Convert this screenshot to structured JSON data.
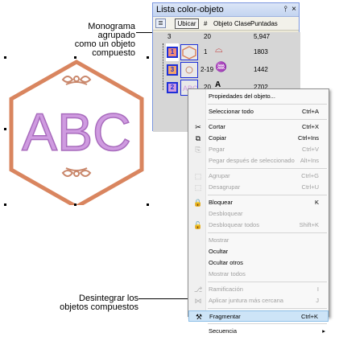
{
  "callouts": {
    "top": [
      "Monograma agrupado",
      "como un objeto",
      "compuesto"
    ],
    "bottom": [
      "Desintegrar los",
      "objetos compuestos"
    ]
  },
  "panel": {
    "title": "Lista color-objeto",
    "title_controls": [
      "p",
      "×"
    ],
    "toolbar": {
      "locate_button": "Ubicar",
      "columns": [
        "#",
        "Objeto",
        "Clase",
        "Puntadas"
      ]
    },
    "header_row": {
      "num": "3",
      "count": "20",
      "stitches": "5,947"
    },
    "rows": [
      {
        "index": "1",
        "num": "1",
        "stitches": "1803"
      },
      {
        "index": "3",
        "num": "2-19",
        "stitches": "1442"
      },
      {
        "index": "2",
        "num": "20",
        "stitches": "2702"
      }
    ]
  },
  "design": {
    "monogram_text": "ABC",
    "colors": {
      "hexagon": "#d9855f",
      "letters": "#cf9be0",
      "letter_stroke": "#a86bbd",
      "ornament": "#c9876b"
    }
  },
  "menu": {
    "items": [
      {
        "label": "Propiedades del objeto...",
        "shortcut": "",
        "disabled": false,
        "icon": ""
      },
      {
        "sep": true
      },
      {
        "label": "Seleccionar todo",
        "shortcut": "Ctrl+A",
        "disabled": false,
        "icon": ""
      },
      {
        "sep": true
      },
      {
        "label": "Cortar",
        "shortcut": "Ctrl+X",
        "disabled": false,
        "icon": "scissors-icon"
      },
      {
        "label": "Copiar",
        "shortcut": "Ctrl+Ins",
        "disabled": false,
        "icon": "copy-icon"
      },
      {
        "label": "Pegar",
        "shortcut": "Ctrl+V",
        "disabled": true,
        "icon": "paste-icon"
      },
      {
        "label": "Pegar después de seleccionado",
        "shortcut": "Alt+Ins",
        "disabled": true,
        "icon": ""
      },
      {
        "sep": true
      },
      {
        "label": "Agrupar",
        "shortcut": "Ctrl+G",
        "disabled": true,
        "icon": "group-icon"
      },
      {
        "label": "Desagrupar",
        "shortcut": "Ctrl+U",
        "disabled": true,
        "icon": "ungroup-icon"
      },
      {
        "sep": true
      },
      {
        "label": "Bloquear",
        "shortcut": "K",
        "disabled": false,
        "icon": "lock-icon"
      },
      {
        "label": "Desbloquear",
        "shortcut": "",
        "disabled": true,
        "icon": ""
      },
      {
        "label": "Desbloquear todos",
        "shortcut": "Shift+K",
        "disabled": true,
        "icon": "unlock-icon"
      },
      {
        "sep": true
      },
      {
        "label": "Mostrar",
        "shortcut": "",
        "disabled": true,
        "icon": ""
      },
      {
        "label": "Ocultar",
        "shortcut": "",
        "disabled": false,
        "icon": ""
      },
      {
        "label": "Ocultar otros",
        "shortcut": "",
        "disabled": false,
        "icon": ""
      },
      {
        "label": "Mostrar todos",
        "shortcut": "",
        "disabled": true,
        "icon": ""
      },
      {
        "sep": true
      },
      {
        "label": "Ramificación",
        "shortcut": "I",
        "disabled": true,
        "icon": "branch-icon"
      },
      {
        "label": "Aplicar juntura más cercana",
        "shortcut": "J",
        "disabled": true,
        "icon": "join-icon"
      },
      {
        "sep": true
      },
      {
        "label": "Fragmentar",
        "shortcut": "Ctrl+K",
        "disabled": false,
        "icon": "break-apart-icon",
        "highlight": true
      },
      {
        "sep": true
      },
      {
        "label": "Secuencia",
        "shortcut": "",
        "disabled": false,
        "icon": "",
        "submenu": true
      }
    ]
  }
}
